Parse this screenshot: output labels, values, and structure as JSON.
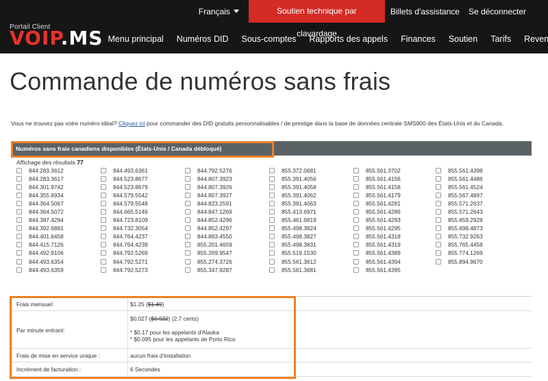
{
  "topbar": {
    "language": "Français",
    "support_button": "Soutien technique par clavardage",
    "tickets": "Billets d'assistance",
    "logout": "Se déconnecter"
  },
  "logo": {
    "subtitle": "Portail Client",
    "brand_red": "VOIP",
    "brand_white": ".MS"
  },
  "nav": [
    "Menu principal",
    "Numéros DID",
    "Sous-comptes",
    "Rapports des appels",
    "Finances",
    "Soutien",
    "Tarifs",
    "Revendeur"
  ],
  "page_title": "Commande de numéros sans frais",
  "intro": {
    "before": "Vous ne trouvez pas votre numéro idéal? ",
    "link": "Cliquez ici",
    "after": " pour commander des DID gratuits personnalisables / de prestige dans la base de données centrale SMS800 des États-Unis et du Canada."
  },
  "section_title": "Numéros sans frais canadiens disponibles (États-Unis / Canada débloqué)",
  "results": {
    "label": "Affichage des résultats",
    "count": "77"
  },
  "numbers": [
    "844.283.3612",
    "844.493.6361",
    "844.792.5276",
    "855.372.0681",
    "855.561.3702",
    "855.561.4398",
    "844.283.3617",
    "844.523.8677",
    "844.807.3923",
    "855.391.4056",
    "855.561.4156",
    "855.561.4486",
    "844.301.9742",
    "844.523.8679",
    "844.807.3926",
    "855.391.4058",
    "855.561.4158",
    "855.561.4524",
    "844.355.6934",
    "844.579.5542",
    "844.807.3927",
    "855.391.4062",
    "855.561.4179",
    "855.567.4897",
    "844.364.5067",
    "844.579.5548",
    "844.823.2591",
    "855.391.4063",
    "855.561.4281",
    "855.571.2637",
    "844.364.5072",
    "844.665.5146",
    "844.847.1269",
    "855.413.6971",
    "855.561.4286",
    "855.571.2643",
    "844.387.4294",
    "844.723.8109",
    "844.852.4296",
    "855.461.6819",
    "855.561.4293",
    "855.659.2928",
    "844.392.6881",
    "844.732.3054",
    "844.852.4297",
    "855.498.3824",
    "855.561.4295",
    "855.698.4873",
    "844.401.6458",
    "844.764.4237",
    "844.883.4550",
    "855.498.3827",
    "855.561.4318",
    "855.732.9263",
    "844.415.7126",
    "844.764.4239",
    "855.201.4659",
    "855.498.3831",
    "855.561.4319",
    "855.765.4458",
    "844.492.9106",
    "844.792.5269",
    "855.269.9547",
    "855.519.1530",
    "855.561.4389",
    "855.774.1269",
    "844.493.6354",
    "844.792.5271",
    "855.274.3726",
    "855.561.3612",
    "855.561.4394",
    "855.894.9670",
    "844.493.6359",
    "844.792.5273",
    "855.347.9287",
    "855.561.3681",
    "855.561.4395",
    ""
  ],
  "pricing": {
    "monthly_label": "Frais mensuel:",
    "monthly_price": "$1.25",
    "monthly_old": "$1.49",
    "per_minute_label": "Par minute entrant:",
    "per_minute_price": "$0.027",
    "per_minute_old": "$0.032",
    "per_minute_cents": "(2.7 cents)",
    "alaska_note": "* $0.17 pour les appelants d'Alaska",
    "puerto_rico_note": "* $0.095 pour les appelants de Porto Rico",
    "setup_label": "Frais de mise en service unique :",
    "setup_value": "aucun frais d'installation",
    "billing_label": "Incrément de facturation :",
    "billing_value": "6 Secondes"
  },
  "colors": {
    "header_bg": "#161616",
    "accent_red": "#d52b26",
    "highlight_orange": "#f07f25",
    "section_bg": "#5b6266",
    "link_blue": "#1f5aa6"
  }
}
